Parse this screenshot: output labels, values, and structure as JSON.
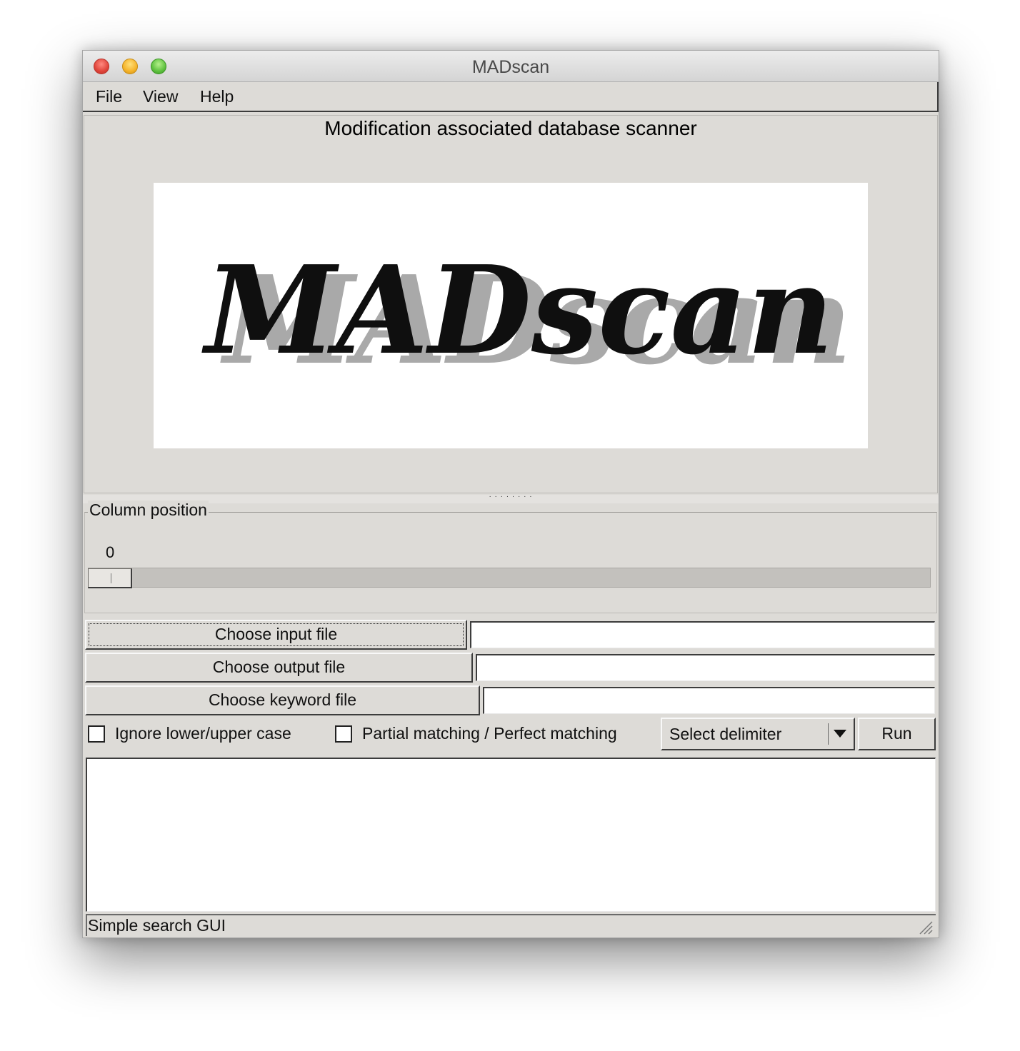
{
  "window": {
    "title": "MADscan"
  },
  "menu": {
    "items": [
      "File",
      "View",
      "Help"
    ]
  },
  "header": {
    "subtitle": "Modification associated database scanner",
    "logo_text": "MADscan"
  },
  "column_position": {
    "label": "Column position",
    "value": "0"
  },
  "files": {
    "input_button": "Choose input file",
    "input_value": "",
    "output_button": "Choose output file",
    "output_value": "",
    "keyword_button": "Choose keyword file",
    "keyword_value": ""
  },
  "options": {
    "ignore_case_label": "Ignore lower/upper case",
    "ignore_case_checked": false,
    "partial_matching_label": "Partial matching / Perfect matching",
    "partial_matching_checked": false,
    "delimiter_selected": "Select delimiter",
    "run_label": "Run"
  },
  "output": {
    "text": ""
  },
  "status": {
    "text": "Simple search GUI"
  },
  "colors": {
    "window_bg": "#dddbd7",
    "close": "#e0443a",
    "minimize": "#f5b32a",
    "maximize": "#5ec13f"
  },
  "icons": [
    "close-icon",
    "minimize-icon",
    "maximize-icon",
    "dropdown-arrow-icon",
    "resize-grip-icon"
  ]
}
